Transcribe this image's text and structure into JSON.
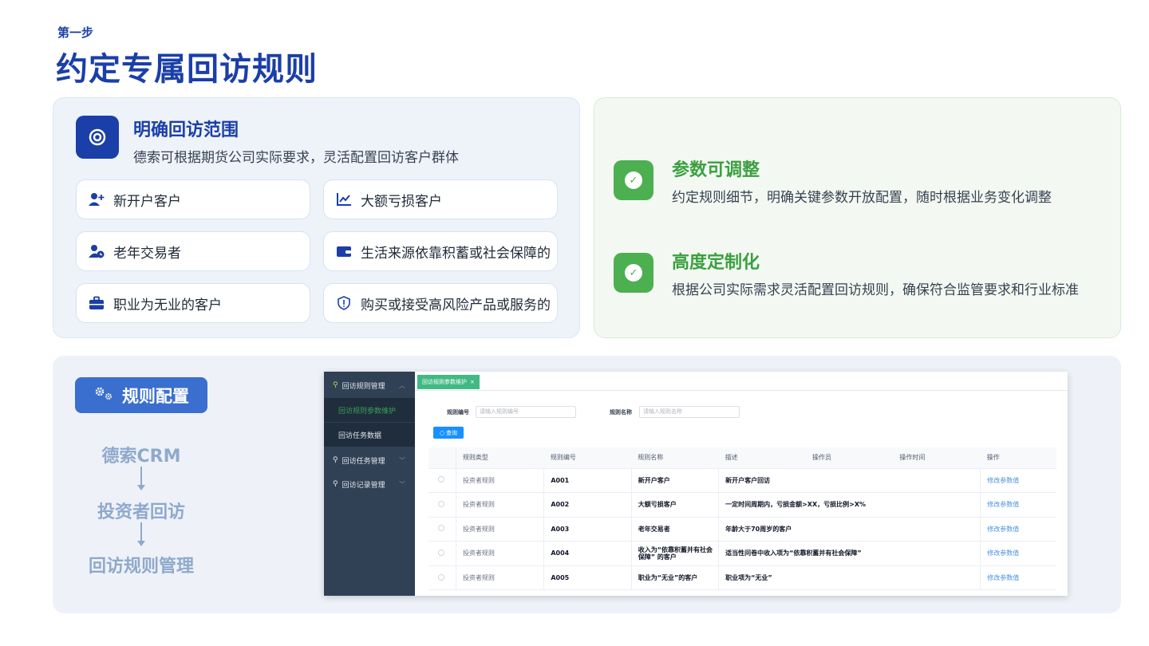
{
  "step_label": "第一步",
  "page_title": "约定专属回访规则",
  "scope": {
    "title": "明确回访范围",
    "description": "德索可根据期货公司实际要求，灵活配置回访客户群体",
    "items": [
      {
        "label": "新开户客户",
        "icon": "user-plus-icon"
      },
      {
        "label": "大额亏损客户",
        "icon": "trend-chart-icon"
      },
      {
        "label": "老年交易者",
        "icon": "user-clock-icon"
      },
      {
        "label": "生活来源依靠积蓄或社会保障的",
        "icon": "wallet-icon"
      },
      {
        "label": "职业为无业的客户",
        "icon": "briefcase-icon"
      },
      {
        "label": "购买或接受高风险产品或服务的",
        "icon": "shield-alert-icon"
      }
    ]
  },
  "features": [
    {
      "title": "参数可调整",
      "description": "约定规则细节，明确关键参数开放配置，随时根据业务变化调整"
    },
    {
      "title": "高度定制化",
      "description": "根据公司实际需求灵活配置回访规则，确保符合监管要求和行业标准"
    }
  ],
  "rule_config": {
    "button_label": "规则配置",
    "flow": [
      "德索CRM",
      "投资者回访",
      "回访规则管理"
    ]
  },
  "app": {
    "sidebar": {
      "menu1": "回访规则管理",
      "sub1": "回访规则参数维护",
      "sub2": "回访任务数据",
      "menu2": "回访任务管理",
      "menu3": "回访记录管理"
    },
    "tab_label": "回访规则参数维护",
    "tab_close": "×",
    "search": {
      "code_label": "规则编号",
      "code_placeholder": "请输入规则编号",
      "name_label": "规则名称",
      "name_placeholder": "请输入规则名称",
      "query_label": "查询"
    },
    "table": {
      "headers": [
        "",
        "规则类型",
        "规则编号",
        "规则名称",
        "描述",
        "操作员",
        "操作时间",
        "操作"
      ],
      "rows": [
        {
          "type": "投资者规则",
          "code": "A001",
          "name": "新开户客户",
          "desc": "新开户客户回访",
          "action": "修改参数值"
        },
        {
          "type": "投资者规则",
          "code": "A002",
          "name": "大额亏损客户",
          "desc": "一定时间周期内，亏损金额>XX，亏损比例>X%",
          "action": "修改参数值"
        },
        {
          "type": "投资者规则",
          "code": "A003",
          "name": "老年交易者",
          "desc": "年龄大于70周岁的客户",
          "action": "修改参数值"
        },
        {
          "type": "投资者规则",
          "code": "A004",
          "name": "收入为“依靠积蓄并有社会保障” 的客户",
          "desc": "适当性问卷中收入项为“依靠积蓄并有社会保障”",
          "action": "修改参数值"
        },
        {
          "type": "投资者规则",
          "code": "A005",
          "name": "职业为“无业”的客户",
          "desc": "职业项为“无业”",
          "action": "修改参数值"
        }
      ]
    }
  },
  "colors": {
    "brand_blue": "#1b3fa8",
    "accent_green": "#4caf50",
    "flow_gray": "#8fa9cc"
  }
}
